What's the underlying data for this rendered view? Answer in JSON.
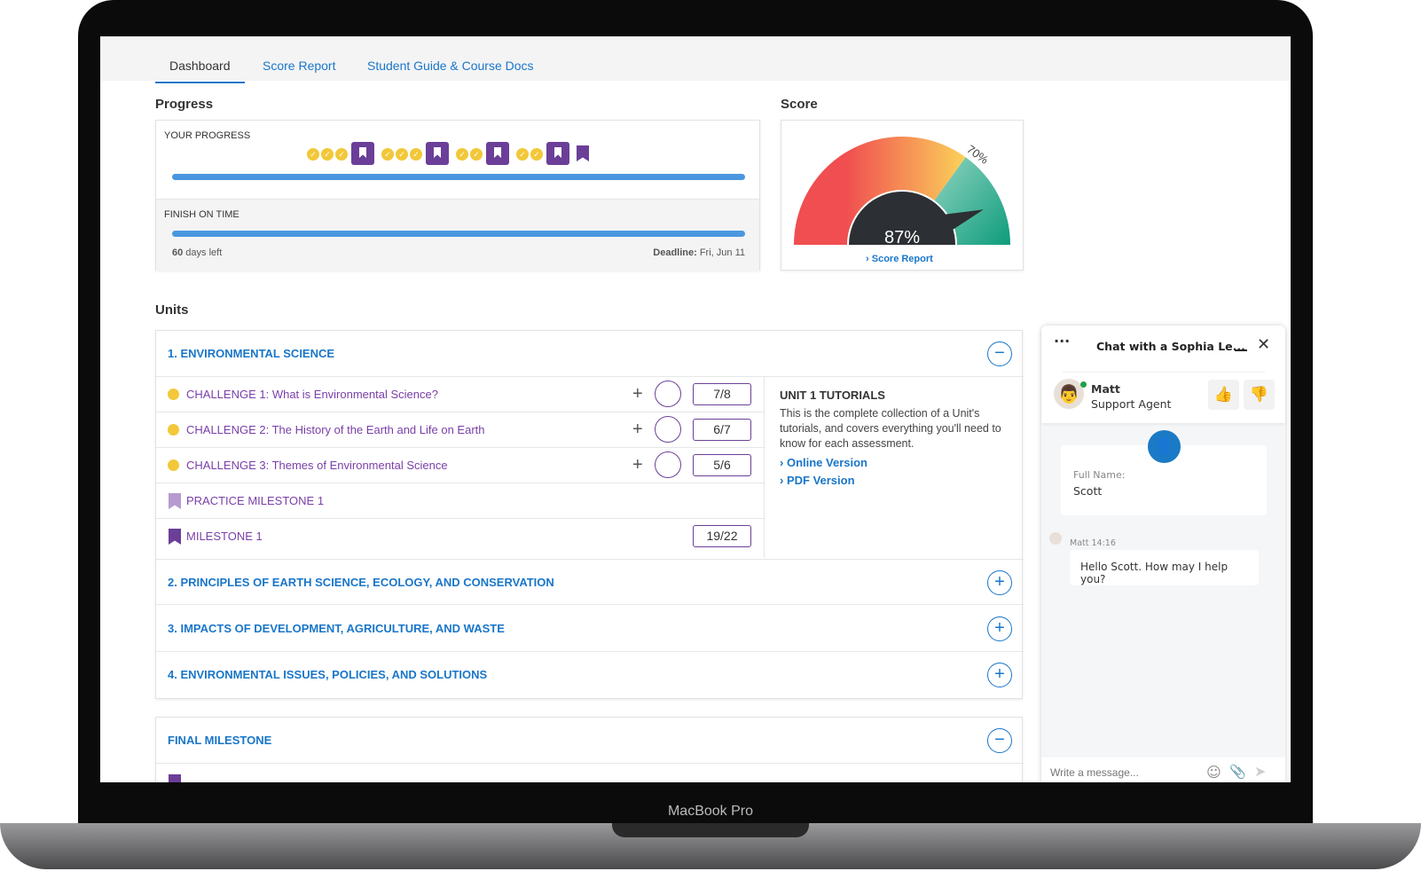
{
  "device": {
    "label": "MacBook Pro"
  },
  "tabs": [
    {
      "label": "Dashboard",
      "active": true
    },
    {
      "label": "Score Report"
    },
    {
      "label": "Student Guide & Course Docs"
    }
  ],
  "progress": {
    "title": "Progress",
    "your_progress_label": "YOUR PROGRESS",
    "your_progress_percent": 100,
    "milestones": [
      {
        "checks": 3,
        "type": "milestone"
      },
      {
        "checks": 3,
        "type": "milestone"
      },
      {
        "checks": 2,
        "type": "milestone"
      },
      {
        "checks": 2,
        "type": "milestone"
      },
      {
        "checks": 0,
        "type": "final"
      }
    ],
    "finish_label": "FINISH ON TIME",
    "finish_percent": 100,
    "days_left_num": "60",
    "days_left_text": " days left",
    "deadline_label": "Deadline:",
    "deadline_value": " Fri, Jun 11"
  },
  "score": {
    "title": "Score",
    "value": 87,
    "value_text": "87%",
    "threshold": 70,
    "threshold_text": "70%",
    "link": "Score Report",
    "colors": {
      "low": "#f04e50",
      "mid": "#fbd25a",
      "high": "#0e9c7c"
    }
  },
  "units": {
    "title": "Units",
    "items": [
      {
        "title": "1. ENVIRONMENTAL SCIENCE",
        "expanded": true,
        "rows": [
          {
            "label": "CHALLENGE 1: What is Environmental Science?",
            "score": "7/8"
          },
          {
            "label": "CHALLENGE 2: The History of the Earth and Life on Earth",
            "score": "6/7"
          },
          {
            "label": "CHALLENGE 3: Themes of Environmental Science",
            "score": "5/6"
          }
        ],
        "practice": "PRACTICE MILESTONE 1",
        "milestone": "MILESTONE 1",
        "milestone_score": "19/22",
        "tutorials": {
          "title": "UNIT 1 TUTORIALS",
          "desc": "This is the complete collection of a Unit's tutorials, and covers everything you'll need to know for each assessment.",
          "links": [
            "Online Version",
            "PDF Version"
          ]
        }
      },
      {
        "title": "2. PRINCIPLES OF EARTH SCIENCE, ECOLOGY, AND CONSERVATION"
      },
      {
        "title": "3. IMPACTS OF DEVELOPMENT, AGRICULTURE, AND WASTE"
      },
      {
        "title": "4. ENVIRONMENTAL ISSUES, POLICIES, AND SOLUTIONS"
      }
    ],
    "final": "FINAL MILESTONE"
  },
  "chat": {
    "title": "Chat with a Sophia Le...",
    "agent_name": "Matt",
    "agent_role": "Support Agent",
    "full_name_label": "Full Name:",
    "full_name": "Scott",
    "msg_meta": "Matt 14:16",
    "message": "Hello Scott. How may I help you?",
    "placeholder": "Write a message..."
  }
}
